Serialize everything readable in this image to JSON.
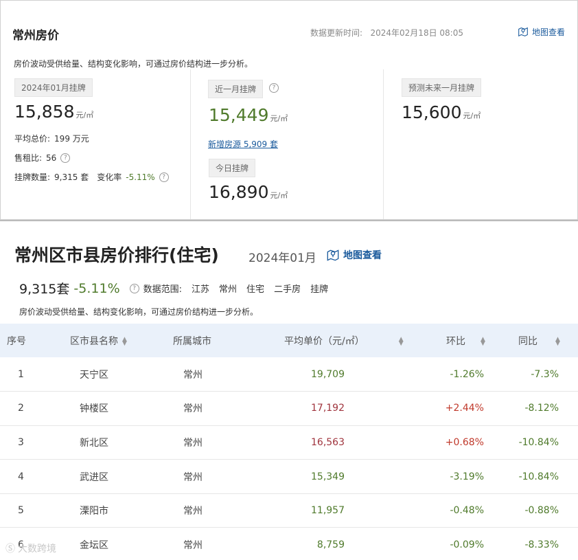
{
  "panel1": {
    "title": "常州房价",
    "update_label": "数据更新时间:",
    "update_time": "2024年02月18日 08:05",
    "map_link": "地图查看",
    "description": "房价波动受供给量、结构变化影响，可通过房价结构进一步分析。",
    "col1": {
      "tag": "2024年01月挂牌",
      "price": "15,858",
      "unit": "元/㎡",
      "avg_total_label": "平均总价:",
      "avg_total_value": "199 万元",
      "rent_ratio_label": "售租比:",
      "rent_ratio_value": "56",
      "listing_label": "挂牌数量:",
      "listing_value": "9,315 套",
      "change_label": "变化率",
      "change_value": "-5.11%"
    },
    "col2": {
      "tag": "近一月挂牌",
      "price": "15,449",
      "unit": "元/㎡",
      "new_listing_link": "新增房源 5,909 套",
      "today_tag": "今日挂牌",
      "today_price": "16,890",
      "today_unit": "元/㎡"
    },
    "col3": {
      "tag": "预测未来一月挂牌",
      "price": "15,600",
      "unit": "元/㎡"
    }
  },
  "panel2": {
    "title": "常州区市县房价排行(住宅)",
    "date": "2024年01月",
    "map_link": "地图查看",
    "count": "9,315套",
    "change": "-5.11%",
    "scope_label": "数据范围:",
    "scope": [
      "江苏",
      "常州",
      "住宅",
      "二手房",
      "挂牌"
    ],
    "description": "房价波动受供给量、结构变化影响，可通过房价结构进一步分析。",
    "table": {
      "headers": [
        "序号",
        "区市县名称",
        "所属城市",
        "平均单价（元/㎡）",
        "环比",
        "同比"
      ],
      "rows": [
        {
          "rank": "1",
          "name": "天宁区",
          "city": "常州",
          "price": "19,709",
          "mom": "-1.26%",
          "yoy": "-7.3%"
        },
        {
          "rank": "2",
          "name": "钟楼区",
          "city": "常州",
          "price": "17,192",
          "mom": "+2.44%",
          "yoy": "-8.12%"
        },
        {
          "rank": "3",
          "name": "新北区",
          "city": "常州",
          "price": "16,563",
          "mom": "+0.68%",
          "yoy": "-10.84%"
        },
        {
          "rank": "4",
          "name": "武进区",
          "city": "常州",
          "price": "15,349",
          "mom": "-3.19%",
          "yoy": "-10.84%"
        },
        {
          "rank": "5",
          "name": "溧阳市",
          "city": "常州",
          "price": "11,957",
          "mom": "-0.48%",
          "yoy": "-0.88%"
        },
        {
          "rank": "6",
          "name": "金坛区",
          "city": "常州",
          "price": "8,759",
          "mom": "-0.09%",
          "yoy": "-8.33%"
        }
      ]
    }
  },
  "watermark": "大数跨境",
  "colors": {
    "green": "#4f7a2b",
    "red": "#c0392b",
    "link": "#1a5a9c",
    "header_bg": "#eaf1fa"
  }
}
